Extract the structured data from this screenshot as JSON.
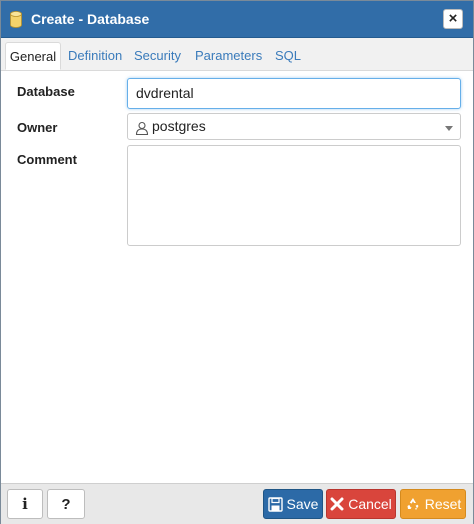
{
  "dialog": {
    "title": "Create - Database",
    "close_label": "×"
  },
  "tabs": [
    {
      "label": "General",
      "active": true
    },
    {
      "label": "Definition",
      "active": false
    },
    {
      "label": "Security",
      "active": false
    },
    {
      "label": "Parameters",
      "active": false
    },
    {
      "label": "SQL",
      "active": false
    }
  ],
  "form": {
    "database_label": "Database",
    "database_value": "dvdrental",
    "owner_label": "Owner",
    "owner_value": "postgres",
    "owner_icon": "user-icon",
    "comment_label": "Comment",
    "comment_value": ""
  },
  "footer": {
    "info_label": "i",
    "help_label": "?",
    "save_label": "Save",
    "cancel_label": "Cancel",
    "reset_label": "Reset"
  },
  "colors": {
    "titlebar": "#316da8",
    "save": "#2c6aa7",
    "cancel": "#d9453c",
    "reset": "#f0a130"
  }
}
